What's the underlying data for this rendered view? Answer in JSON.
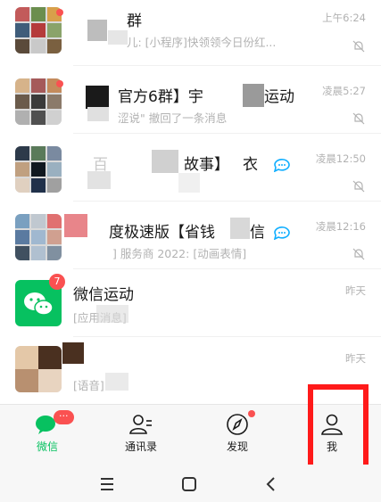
{
  "chats": [
    {
      "name": "群",
      "preview": "儿: [小程序]快领领今日份红...",
      "time": "上午6:24",
      "muted": true,
      "unread_dot": true
    },
    {
      "name": "官方6群】宇",
      "name_suffix": "运动",
      "preview": "涩说\" 撤回了一条消息",
      "time": "凌晨5:27",
      "muted": true,
      "unread_dot": true
    },
    {
      "name_prefix": "百",
      "name": "故事】",
      "name_suffix": "衣",
      "preview": "",
      "time": "凌晨12:50",
      "muted": true,
      "unread_dot": false
    },
    {
      "name": "度极速版【省钱",
      "name_suffix": "信",
      "preview": "] 服务商 2022: [动画表情]",
      "time": "凌晨12:16",
      "muted": true,
      "unread_dot": false
    },
    {
      "name": "微信运动",
      "preview": "[应用消息]",
      "time": "昨天",
      "muted": false,
      "unread_count": "7"
    },
    {
      "name": "",
      "preview": "[语音]",
      "time": "昨天",
      "muted": false
    }
  ],
  "tabbar": {
    "chats_label": "微信",
    "chats_badge": "···",
    "contacts_label": "通讯录",
    "discover_label": "发现",
    "me_label": "我"
  },
  "colors": {
    "accent": "#07c160",
    "badge": "#fa5151",
    "highlight": "#ff1a1a"
  }
}
